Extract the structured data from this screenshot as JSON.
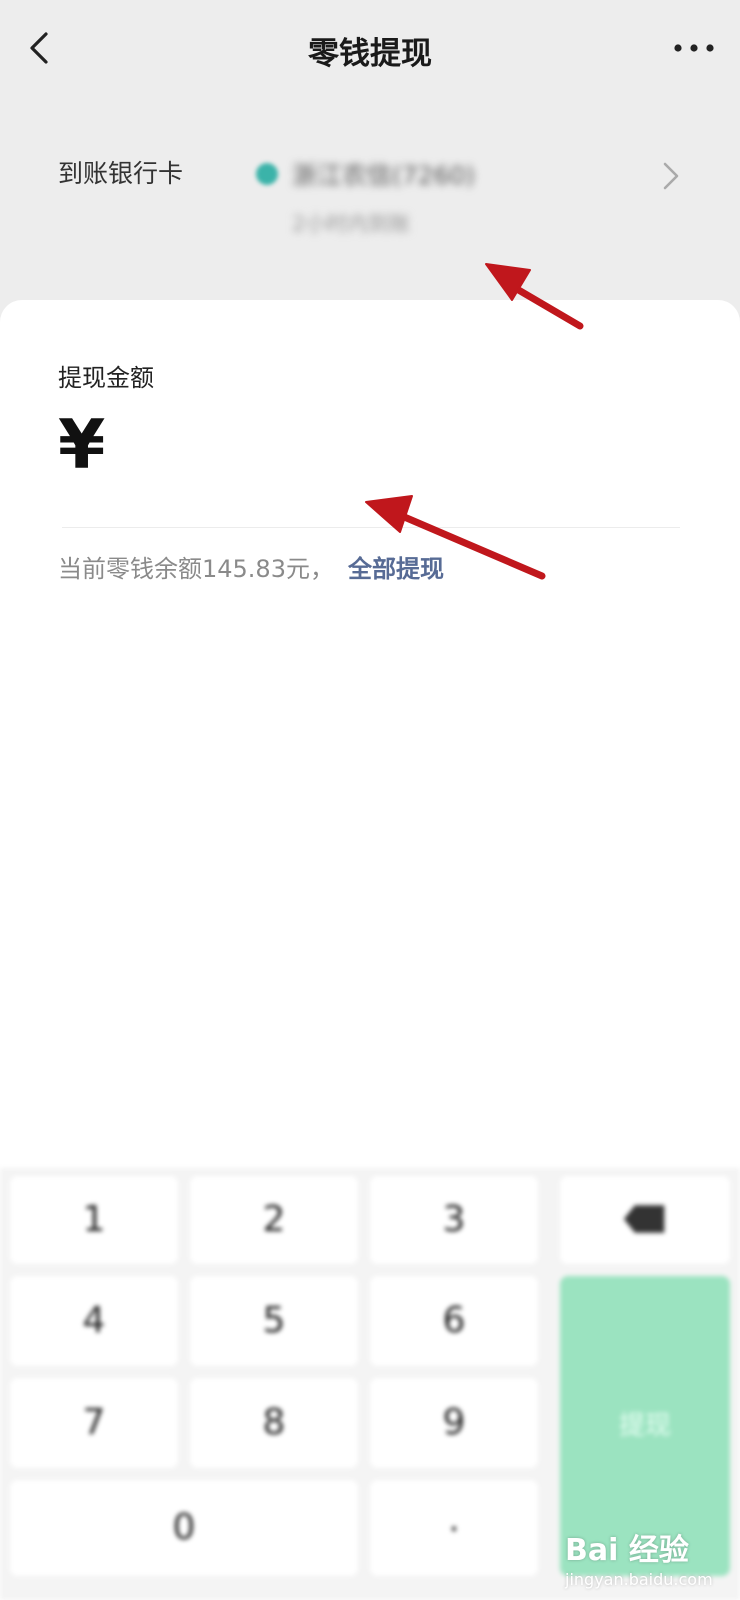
{
  "header": {
    "title": "零钱提现",
    "back_icon": "chevron-left-icon",
    "more_icon": "more-dots-icon"
  },
  "card": {
    "label": "到账银行卡",
    "bank_name": "浙江农信(7260)",
    "arrival_note": "2小时内到账"
  },
  "amount": {
    "label": "提现金额",
    "currency_symbol": "¥",
    "balance_text": "当前零钱余额145.83元，",
    "withdraw_all_label": "全部提现"
  },
  "keypad": {
    "keys": [
      "1",
      "2",
      "3",
      "4",
      "5",
      "6",
      "7",
      "8",
      "9",
      "0",
      "."
    ],
    "delete_icon": "backspace-icon",
    "confirm_label": "提现"
  },
  "watermark": {
    "logo": "Bai 经验",
    "url": "jingyan.baidu.com"
  },
  "colors": {
    "link": "#576b95",
    "confirm": "#9be3c0",
    "annotation": "#c0171c"
  }
}
